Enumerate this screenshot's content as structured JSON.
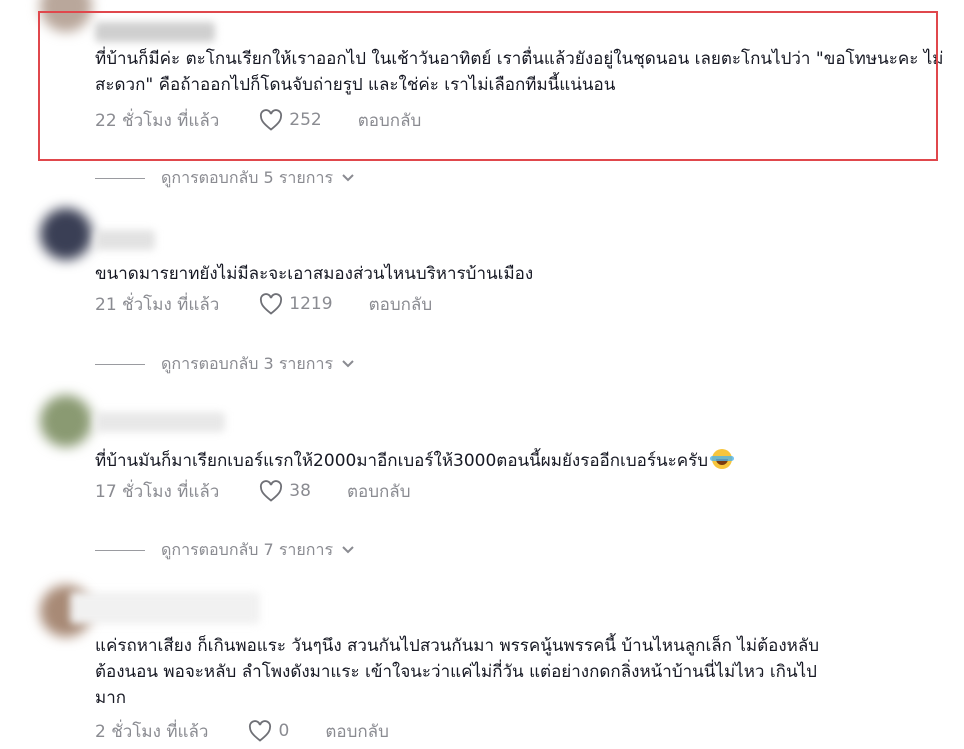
{
  "comments": [
    {
      "text": "ที่บ้านก็มีค่ะ ตะโกนเรียกให้เราออกไป ในเช้าวันอาทิตย์ เราตื่นแล้วยังอยู่ในชุดนอน เลยตะโกนไปว่า \"ขอโทษนะคะ ไม่สะดวก\" คือถ้าออกไปก็โดนจับถ่ายรูป และใช่ค่ะ เราไม่เลือกทีมนี้แน่นอน",
      "time": "22 ชั่วโมง ที่แล้ว",
      "likes": "252",
      "reply": "ตอบกลับ",
      "view_replies": "ดูการตอบกลับ 5 รายการ"
    },
    {
      "text": "ขนาดมารยาทยังไม่มีละจะเอาสมองส่วนไหนบริหารบ้านเมือง",
      "time": "21 ชั่วโมง ที่แล้ว",
      "likes": "1219",
      "reply": "ตอบกลับ",
      "view_replies": "ดูการตอบกลับ 3 รายการ"
    },
    {
      "text": "ที่บ้านมันก็มาเรียกเบอร์แรกให้2000มาอีกเบอร์ให้3000ตอนนี้ผมยังรออีกเบอร์นะครับ",
      "time": "17 ชั่วโมง ที่แล้ว",
      "likes": "38",
      "reply": "ตอบกลับ",
      "view_replies": "ดูการตอบกลับ 7 รายการ"
    },
    {
      "text": "แค่รถหาเสียง ก็เกินพอแระ วันๆนึง สวนกันไปสวนกันมา พรรคนู้นพรรคนี้ บ้านไหนลูกเล็ก ไม่ต้องหลับ\nต้องนอน พอจะหลับ ลำโพงดังมาแระ เข้าใจนะว่าแค่ไม่กี่วัน แต่อย่างกดกลิ่งหน้าบ้านนี่ไม่ไหว เกินไป\nมาก",
      "time": "2 ชั่วโมง ที่แล้ว",
      "likes": "0",
      "reply": "ตอบกลับ"
    }
  ],
  "icons": {
    "like": "heart-outline-icon",
    "expand": "chevron-down-icon",
    "emoji": "laughing-tears-emoji"
  },
  "colors": {
    "text": "#161823",
    "muted": "#8a8b91",
    "highlight": "#e0474c"
  }
}
